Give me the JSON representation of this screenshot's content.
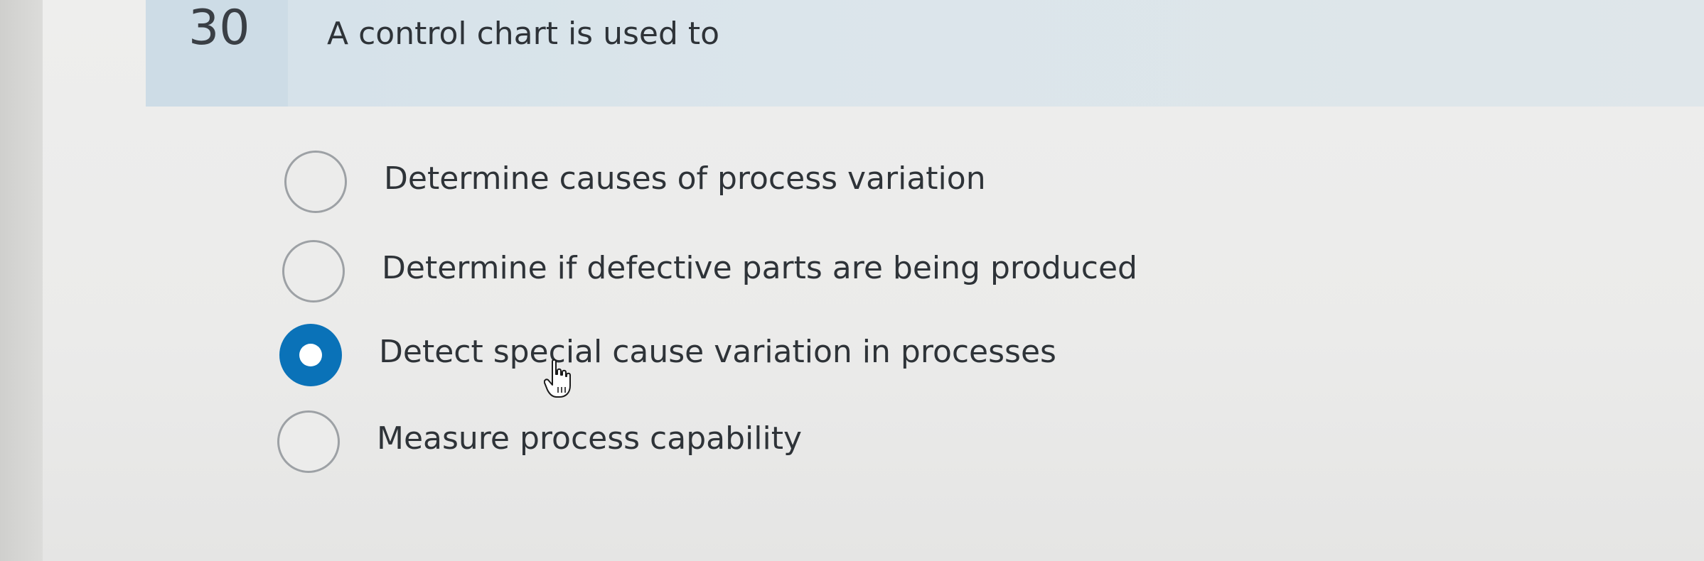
{
  "question": {
    "number": "30",
    "text": "A control chart is used to"
  },
  "options": [
    {
      "label": "Determine causes of process variation",
      "selected": false
    },
    {
      "label": "Determine if defective parts are being produced",
      "selected": false
    },
    {
      "label": "Detect special cause variation in processes",
      "selected": true
    },
    {
      "label": "Measure process capability",
      "selected": false
    }
  ],
  "colors": {
    "accent": "#0a72b8",
    "header_background": "#dbe5eb",
    "text": "#2e3338"
  },
  "icons": {
    "cursor": "hand-pointer-icon"
  }
}
